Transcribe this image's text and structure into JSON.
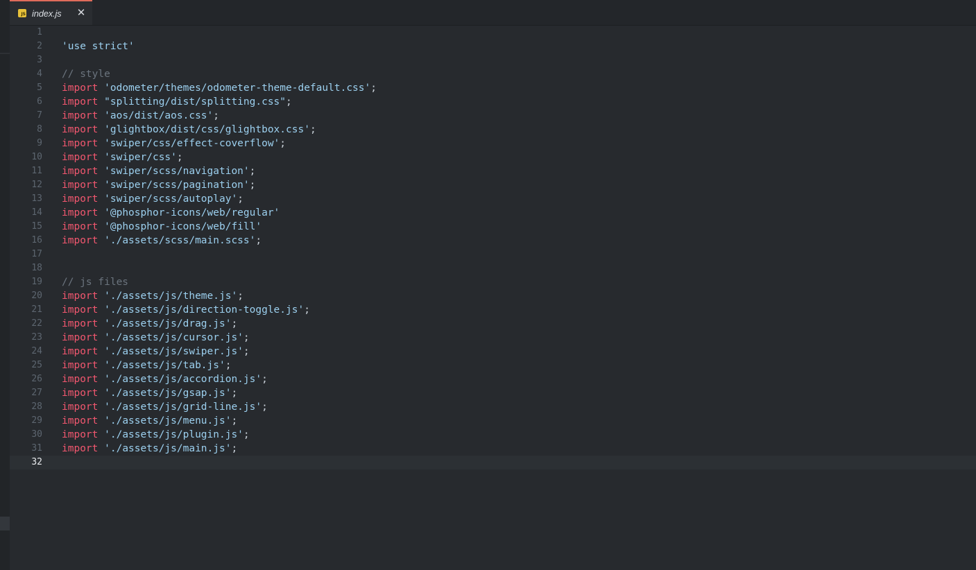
{
  "tab": {
    "icon_text": "JS",
    "title": "index.js",
    "close_glyph": "✕",
    "accent_color": "#e06c5b"
  },
  "editor": {
    "current_line": 32,
    "lines": [
      {
        "n": "1",
        "kind": "blank",
        "text": ""
      },
      {
        "n": "2",
        "kind": "directive",
        "text": "'use strict'"
      },
      {
        "n": "3",
        "kind": "blank",
        "text": ""
      },
      {
        "n": "4",
        "kind": "comment",
        "text": "// style"
      },
      {
        "n": "5",
        "kind": "import",
        "kw": "import",
        "str": "'odometer/themes/odometer-theme-default.css'",
        "end": ";"
      },
      {
        "n": "6",
        "kind": "import",
        "kw": "import",
        "str": "\"splitting/dist/splitting.css\"",
        "end": ";"
      },
      {
        "n": "7",
        "kind": "import",
        "kw": "import",
        "str": "'aos/dist/aos.css'",
        "end": ";"
      },
      {
        "n": "8",
        "kind": "import",
        "kw": "import",
        "str": "'glightbox/dist/css/glightbox.css'",
        "end": ";"
      },
      {
        "n": "9",
        "kind": "import",
        "kw": "import",
        "str": "'swiper/css/effect-coverflow'",
        "end": ";"
      },
      {
        "n": "10",
        "kind": "import",
        "kw": "import",
        "str": "'swiper/css'",
        "end": ";"
      },
      {
        "n": "11",
        "kind": "import",
        "kw": "import",
        "str": "'swiper/scss/navigation'",
        "end": ";"
      },
      {
        "n": "12",
        "kind": "import",
        "kw": "import",
        "str": "'swiper/scss/pagination'",
        "end": ";"
      },
      {
        "n": "13",
        "kind": "import",
        "kw": "import",
        "str": "'swiper/scss/autoplay'",
        "end": ";"
      },
      {
        "n": "14",
        "kind": "import",
        "kw": "import",
        "str": "'@phosphor-icons/web/regular'",
        "end": ""
      },
      {
        "n": "15",
        "kind": "import",
        "kw": "import",
        "str": "'@phosphor-icons/web/fill'",
        "end": ""
      },
      {
        "n": "16",
        "kind": "import",
        "kw": "import",
        "str": "'./assets/scss/main.scss'",
        "end": ";"
      },
      {
        "n": "17",
        "kind": "blank",
        "text": ""
      },
      {
        "n": "18",
        "kind": "blank",
        "text": ""
      },
      {
        "n": "19",
        "kind": "comment",
        "text": "// js files"
      },
      {
        "n": "20",
        "kind": "import",
        "kw": "import",
        "str": "'./assets/js/theme.js'",
        "end": ";"
      },
      {
        "n": "21",
        "kind": "import",
        "kw": "import",
        "str": "'./assets/js/direction-toggle.js'",
        "end": ";"
      },
      {
        "n": "22",
        "kind": "import",
        "kw": "import",
        "str": "'./assets/js/drag.js'",
        "end": ";"
      },
      {
        "n": "23",
        "kind": "import",
        "kw": "import",
        "str": "'./assets/js/cursor.js'",
        "end": ";"
      },
      {
        "n": "24",
        "kind": "import",
        "kw": "import",
        "str": "'./assets/js/swiper.js'",
        "end": ";"
      },
      {
        "n": "25",
        "kind": "import",
        "kw": "import",
        "str": "'./assets/js/tab.js'",
        "end": ";"
      },
      {
        "n": "26",
        "kind": "import",
        "kw": "import",
        "str": "'./assets/js/accordion.js'",
        "end": ";"
      },
      {
        "n": "27",
        "kind": "import",
        "kw": "import",
        "str": "'./assets/js/gsap.js'",
        "end": ";"
      },
      {
        "n": "28",
        "kind": "import",
        "kw": "import",
        "str": "'./assets/js/grid-line.js'",
        "end": ";"
      },
      {
        "n": "29",
        "kind": "import",
        "kw": "import",
        "str": "'./assets/js/menu.js'",
        "end": ";"
      },
      {
        "n": "30",
        "kind": "import",
        "kw": "import",
        "str": "'./assets/js/plugin.js'",
        "end": ";"
      },
      {
        "n": "31",
        "kind": "import",
        "kw": "import",
        "str": "'./assets/js/main.js'",
        "end": ";"
      },
      {
        "n": "32",
        "kind": "blank",
        "text": ""
      }
    ]
  }
}
